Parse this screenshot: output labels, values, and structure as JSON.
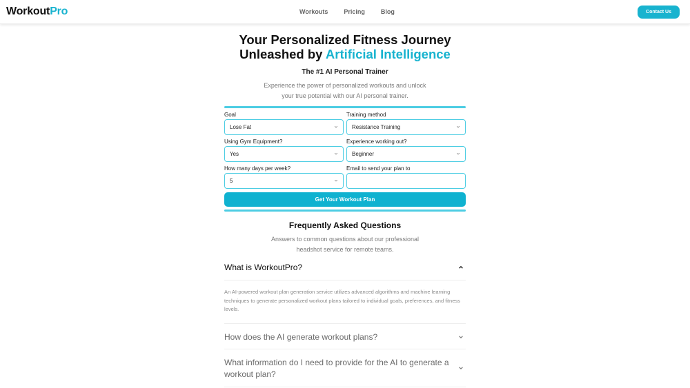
{
  "navbar": {
    "logo_main": "Workout",
    "logo_accent": "Pro",
    "links": [
      "Workouts",
      "Pricing",
      "Blog"
    ],
    "contact_label": "Contact Us"
  },
  "colors": {
    "accent": "#18b3cf",
    "rule": "#4ccde3",
    "button": "#0fb2d0"
  },
  "hero": {
    "title_line1": "Your Personalized Fitness Journey",
    "title_line2_plain": "Unleashed by ",
    "title_line2_accent": "Artificial Intelligence",
    "subtitle": "The #1 AI Personal Trainer",
    "description_line1": "Experience the power of personalized workouts and unlock",
    "description_line2": "your true potential with our AI personal trainer."
  },
  "form": {
    "fields": [
      {
        "label": "Goal",
        "value": "Lose Fat",
        "type": "select"
      },
      {
        "label": "Training method",
        "value": "Resistance Training",
        "type": "select"
      },
      {
        "label": "Using Gym Equipment?",
        "value": "Yes",
        "type": "select"
      },
      {
        "label": "Experience working out?",
        "value": "Beginner",
        "type": "select"
      },
      {
        "label": "How many days per week?",
        "value": "5",
        "type": "select"
      },
      {
        "label": "Email to send your plan to",
        "value": "",
        "placeholder": "",
        "type": "input"
      }
    ],
    "submit_label": "Get Your Workout Plan"
  },
  "faq": {
    "title": "Frequently Asked Questions",
    "subtitle_line1": "Answers to common questions about our professional",
    "subtitle_line2": "headshot service for remote teams.",
    "items": [
      {
        "question": "What is WorkoutPro?",
        "expanded": true,
        "answer": "An AI-powered workout plan generation service utilizes advanced algorithms and machine learning techniques to generate personalized workout plans tailored to individual goals, preferences, and fitness levels."
      },
      {
        "question": "How does the AI generate workout plans?",
        "expanded": false
      },
      {
        "question": "What information do I need to provide for the AI to generate a workout plan?",
        "expanded": false
      }
    ]
  }
}
